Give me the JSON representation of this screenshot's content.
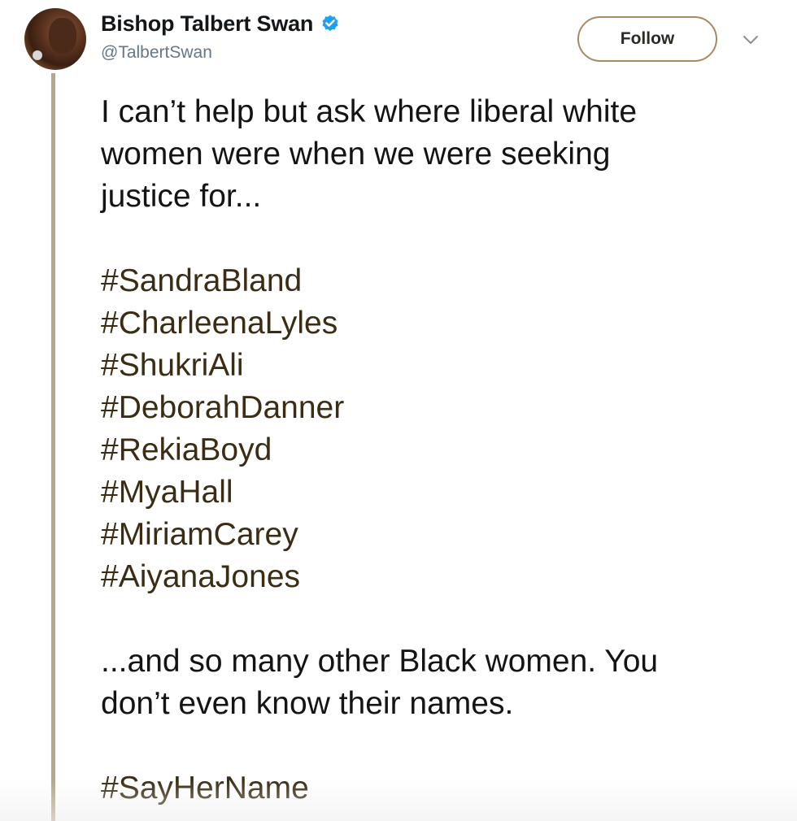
{
  "tweet": {
    "author": {
      "display_name": "Bishop Talbert Swan",
      "handle": "@TalbertSwan",
      "verified": true,
      "avatar_icon": "avatar-photo"
    },
    "follow_label": "Follow",
    "text_intro": [
      "I can’t help but ask where liberal white",
      "women were when we were seeking",
      "justice for..."
    ],
    "hashtags": [
      "#SandraBland",
      "#CharleenaLyles",
      "#ShukriAli",
      "#DeborahDanner",
      "#RekiaBoyd",
      "#MyaHall",
      "#MiriamCarey",
      "#AiyanaJones"
    ],
    "text_outro": [
      "...and so many other Black women. You",
      "don’t even know their names."
    ],
    "closing_hashtag": "#SayHerName"
  },
  "colors": {
    "accent": "#a48b62",
    "hashtag": "#3b2c14",
    "verified_badge": "#1da1f2",
    "thread_line": "#b7a78a"
  },
  "icons": {
    "verified": "verified-badge-icon",
    "menu": "chevron-down-icon"
  }
}
